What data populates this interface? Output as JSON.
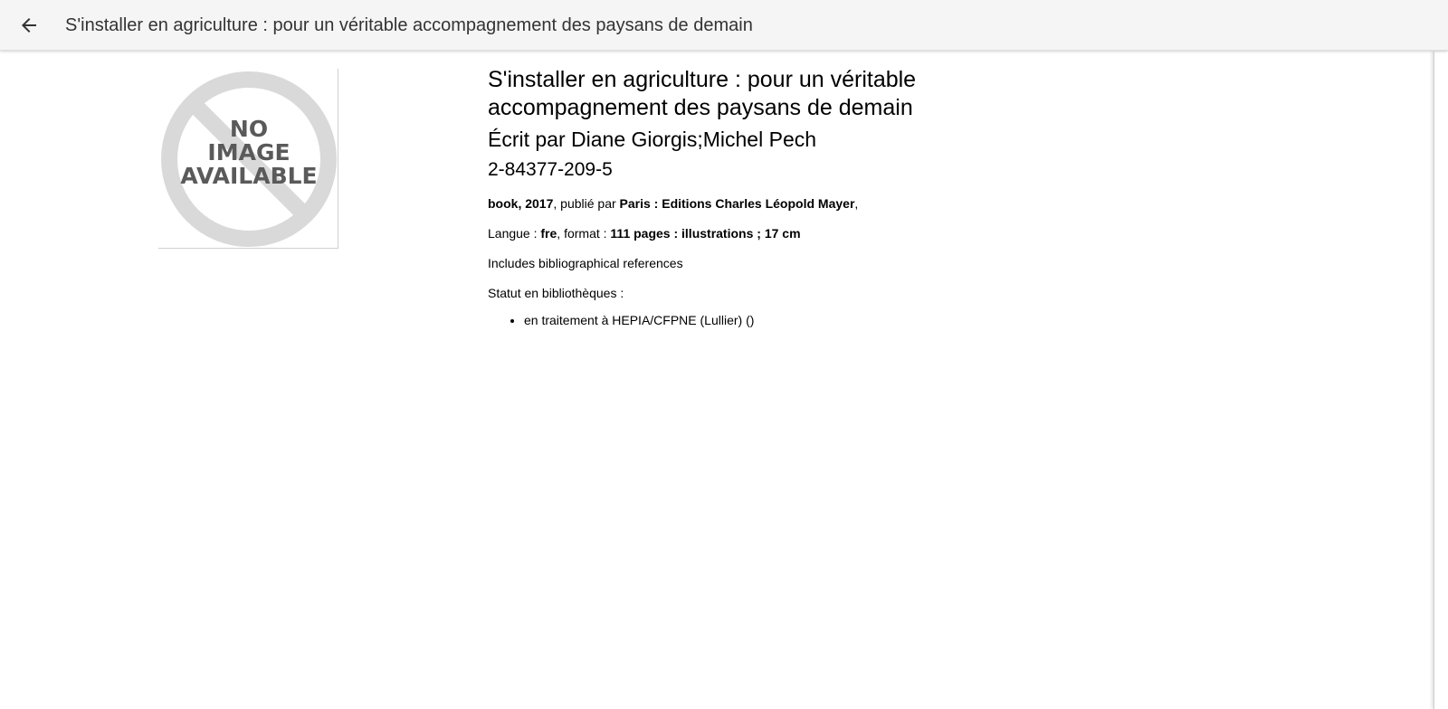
{
  "topbar": {
    "back_icon": "arrow-left-icon",
    "title": "S'installer en agriculture : pour un véritable accompagnement des paysans de demain"
  },
  "cover": {
    "placeholder_lines": [
      "NO",
      "IMAGE",
      "AVAILABLE"
    ],
    "color": "#d9d9d9",
    "text_color": "#5a5a5a"
  },
  "book": {
    "title": "S'installer en agriculture : pour un véritable accompagnement des paysans de demain",
    "authors": "Écrit par Diane Giorgis;Michel Pech",
    "isbn": "2-84377-209-5",
    "pub": {
      "type_year": "book, 2017",
      "published_by_label": ", publié par ",
      "publisher": "Paris : Editions Charles Léopold Mayer",
      "trailing": ","
    },
    "lang": {
      "label": "Langue : ",
      "value": "fre",
      "format_label": ", format : ",
      "format_value": "111 pages : illustrations ; 17 cm"
    },
    "note": "Includes bibliographical references",
    "status_label": "Statut en bibliothèques :",
    "statuses": [
      "en traitement à HEPIA/CFPNE (Lullier) ()"
    ]
  }
}
